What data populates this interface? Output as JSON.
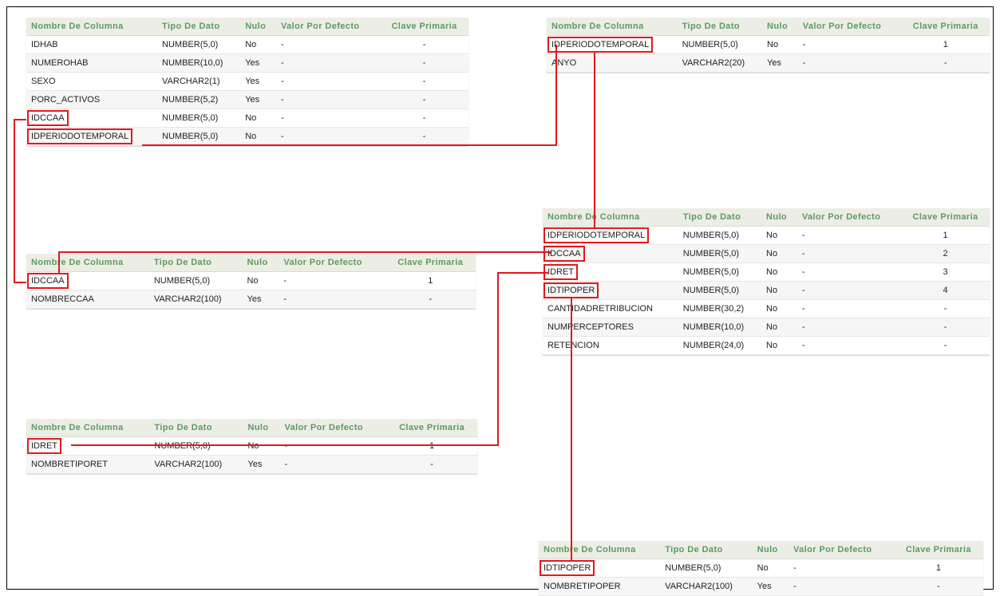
{
  "headers": [
    "Nombre De Columna",
    "Tipo De Dato",
    "Nulo",
    "Valor Por Defecto",
    "Clave Primaria"
  ],
  "tables": [
    {
      "id": "t1",
      "rows": [
        {
          "name": "IDHAB",
          "type": "NUMBER(5,0)",
          "nullable": "No",
          "def": "-",
          "pk": "-",
          "highlight": false
        },
        {
          "name": "NUMEROHAB",
          "type": "NUMBER(10,0)",
          "nullable": "Yes",
          "def": "-",
          "pk": "-",
          "highlight": false
        },
        {
          "name": "SEXO",
          "type": "VARCHAR2(1)",
          "nullable": "Yes",
          "def": "-",
          "pk": "-",
          "highlight": false
        },
        {
          "name": "PORC_ACTIVOS",
          "type": "NUMBER(5,2)",
          "nullable": "Yes",
          "def": "-",
          "pk": "-",
          "highlight": false
        },
        {
          "name": "IDCCAA",
          "type": "NUMBER(5,0)",
          "nullable": "No",
          "def": "-",
          "pk": "-",
          "highlight": true
        },
        {
          "name": "IDPERIODOTEMPORAL",
          "type": "NUMBER(5,0)",
          "nullable": "No",
          "def": "-",
          "pk": "-",
          "highlight": true
        }
      ]
    },
    {
      "id": "t2",
      "rows": [
        {
          "name": "IDPERIODOTEMPORAL",
          "type": "NUMBER(5,0)",
          "nullable": "No",
          "def": "-",
          "pk": "1",
          "highlight": true
        },
        {
          "name": "ANYO",
          "type": "VARCHAR2(20)",
          "nullable": "Yes",
          "def": "-",
          "pk": "-",
          "highlight": false
        }
      ]
    },
    {
      "id": "t3",
      "rows": [
        {
          "name": "IDCCAA",
          "type": "NUMBER(5,0)",
          "nullable": "No",
          "def": "-",
          "pk": "1",
          "highlight": true
        },
        {
          "name": "NOMBRECCAA",
          "type": "VARCHAR2(100)",
          "nullable": "Yes",
          "def": "-",
          "pk": "-",
          "highlight": false
        }
      ]
    },
    {
      "id": "t4",
      "rows": [
        {
          "name": "IDPERIODOTEMPORAL",
          "type": "NUMBER(5,0)",
          "nullable": "No",
          "def": "-",
          "pk": "1",
          "highlight": true
        },
        {
          "name": "IDCCAA",
          "type": "NUMBER(5,0)",
          "nullable": "No",
          "def": "-",
          "pk": "2",
          "highlight": true
        },
        {
          "name": "IDRET",
          "type": "NUMBER(5,0)",
          "nullable": "No",
          "def": "-",
          "pk": "3",
          "highlight": true
        },
        {
          "name": "IDTIPOPER",
          "type": "NUMBER(5,0)",
          "nullable": "No",
          "def": "-",
          "pk": "4",
          "highlight": true
        },
        {
          "name": "CANTIDADRETRIBUCION",
          "type": "NUMBER(30,2)",
          "nullable": "No",
          "def": "-",
          "pk": "-",
          "highlight": false
        },
        {
          "name": "NUMPERCEPTORES",
          "type": "NUMBER(10,0)",
          "nullable": "No",
          "def": "-",
          "pk": "-",
          "highlight": false
        },
        {
          "name": "RETENCION",
          "type": "NUMBER(24,0)",
          "nullable": "No",
          "def": "-",
          "pk": "-",
          "highlight": false
        }
      ]
    },
    {
      "id": "t5",
      "rows": [
        {
          "name": "IDRET",
          "type": "NUMBER(5,0)",
          "nullable": "No",
          "def": "-",
          "pk": "1",
          "highlight": true
        },
        {
          "name": "NOMBRETIPORET",
          "type": "VARCHAR2(100)",
          "nullable": "Yes",
          "def": "-",
          "pk": "-",
          "highlight": false
        }
      ]
    },
    {
      "id": "t6",
      "rows": [
        {
          "name": "IDTIPOPER",
          "type": "NUMBER(5,0)",
          "nullable": "No",
          "def": "-",
          "pk": "1",
          "highlight": true
        },
        {
          "name": "NOMBRETIPOPER",
          "type": "VARCHAR2(100)",
          "nullable": "Yes",
          "def": "-",
          "pk": "-",
          "highlight": false
        }
      ]
    }
  ],
  "colors": {
    "link_line": "#e0191e",
    "header_text": "#5e9a5e",
    "header_bg": "#eceee6"
  }
}
